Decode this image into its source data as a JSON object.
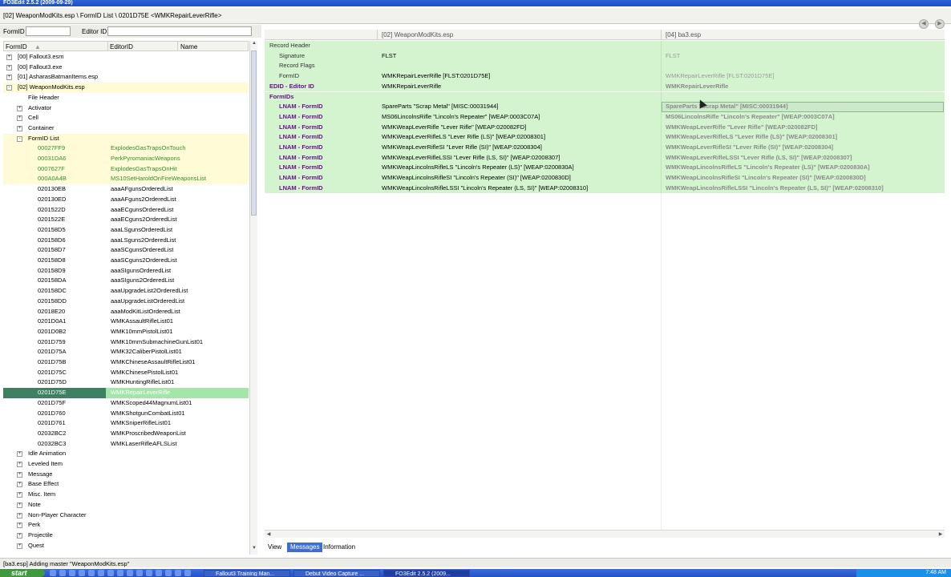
{
  "window": {
    "title": "FO3Edit 2.5.2 (2009-09-29)"
  },
  "path": {
    "text": "[02] WeaponModKits.esp \\ FormID List \\ 0201D75E <WMKRepairLeverRifle>"
  },
  "filter": {
    "formid_label": "FormID",
    "editorid_label": "Editor ID",
    "formid_value": "",
    "editorid_value": ""
  },
  "left_columns": {
    "formid": "FormID",
    "editorid": "EditorID",
    "name": "Name"
  },
  "tree": [
    {
      "indent": 0,
      "exp": "+",
      "text": "[00] Fallout3.esm",
      "edid": "",
      "hl": false
    },
    {
      "indent": 0,
      "exp": "+",
      "text": "[00] Fallout3.exe",
      "edid": "",
      "hl": false
    },
    {
      "indent": 0,
      "exp": "+",
      "text": "[01] AsharasBatmanItems.esp",
      "edid": "",
      "hl": false
    },
    {
      "indent": 0,
      "exp": "-",
      "text": "[02] WeaponModKits.esp",
      "edid": "",
      "hl": true
    },
    {
      "indent": 1,
      "exp": "",
      "text": "File Header",
      "edid": "",
      "hl": false
    },
    {
      "indent": 1,
      "exp": "+",
      "text": "Activator",
      "edid": "",
      "hl": false
    },
    {
      "indent": 1,
      "exp": "+",
      "text": "Cell",
      "edid": "",
      "hl": false
    },
    {
      "indent": 1,
      "exp": "+",
      "text": "Container",
      "edid": "",
      "hl": false
    },
    {
      "indent": 1,
      "exp": "-",
      "text": "FormID List",
      "edid": "",
      "hl": true
    },
    {
      "indent": 2,
      "exp": "",
      "text": "00027FF9",
      "edid": "ExplodesGasTrapsOnTouch",
      "hl": true,
      "green": true
    },
    {
      "indent": 2,
      "exp": "",
      "text": "00031DA6",
      "edid": "PerkPyromaniacWeapons",
      "hl": true,
      "green": true
    },
    {
      "indent": 2,
      "exp": "",
      "text": "0007627F",
      "edid": "ExplodesGasTrapsOnHit",
      "hl": true,
      "green": true
    },
    {
      "indent": 2,
      "exp": "",
      "text": "000A0A4B",
      "edid": "MS10SetHaroldOnFireWeaponsList",
      "hl": true,
      "green": true
    },
    {
      "indent": 2,
      "exp": "",
      "text": "020130EB",
      "edid": "aaaAFgunsOrderedList",
      "hl": false
    },
    {
      "indent": 2,
      "exp": "",
      "text": "020130ED",
      "edid": "aaaAFguns2OrderedList",
      "hl": false
    },
    {
      "indent": 2,
      "exp": "",
      "text": "0201522D",
      "edid": "aaaECgunsOrderedList",
      "hl": false
    },
    {
      "indent": 2,
      "exp": "",
      "text": "0201522E",
      "edid": "aaaECguns2OrderedList",
      "hl": false
    },
    {
      "indent": 2,
      "exp": "",
      "text": "020158D5",
      "edid": "aaaLSgunsOrderedList",
      "hl": false
    },
    {
      "indent": 2,
      "exp": "",
      "text": "020158D6",
      "edid": "aaaLSguns2OrderedList",
      "hl": false
    },
    {
      "indent": 2,
      "exp": "",
      "text": "020158D7",
      "edid": "aaaSCgunsOrderedList",
      "hl": false
    },
    {
      "indent": 2,
      "exp": "",
      "text": "020158D8",
      "edid": "aaaSCguns2OrderedList",
      "hl": false
    },
    {
      "indent": 2,
      "exp": "",
      "text": "020158D9",
      "edid": "aaaSIgunsOrderedList",
      "hl": false
    },
    {
      "indent": 2,
      "exp": "",
      "text": "020158DA",
      "edid": "aaaSIguns2OrderedList",
      "hl": false
    },
    {
      "indent": 2,
      "exp": "",
      "text": "020158DC",
      "edid": "aaaUpgradeList2OrderedList",
      "hl": false
    },
    {
      "indent": 2,
      "exp": "",
      "text": "020158DD",
      "edid": "aaaUpgradeListOrderedList",
      "hl": false
    },
    {
      "indent": 2,
      "exp": "",
      "text": "02018E20",
      "edid": "aaaModKitListOrderedList",
      "hl": false
    },
    {
      "indent": 2,
      "exp": "",
      "text": "0201D0A1",
      "edid": "WMKAssaultRifleList01",
      "hl": false
    },
    {
      "indent": 2,
      "exp": "",
      "text": "0201D0B2",
      "edid": "WMK10mmPistolList01",
      "hl": false
    },
    {
      "indent": 2,
      "exp": "",
      "text": "0201D759",
      "edid": "WMK10mmSubmachineGunList01",
      "hl": false
    },
    {
      "indent": 2,
      "exp": "",
      "text": "0201D75A",
      "edid": "WMK32CaliberPistolList01",
      "hl": false
    },
    {
      "indent": 2,
      "exp": "",
      "text": "0201D75B",
      "edid": "WMKChineseAssaultRifleList01",
      "hl": false
    },
    {
      "indent": 2,
      "exp": "",
      "text": "0201D75C",
      "edid": "WMKChinesePistolList01",
      "hl": false
    },
    {
      "indent": 2,
      "exp": "",
      "text": "0201D75D",
      "edid": "WMKHuntingRifleList01",
      "hl": false
    },
    {
      "indent": 2,
      "exp": "",
      "text": "0201D75E",
      "edid": "WMKRepairLeverRifle",
      "hl": false,
      "selected": true
    },
    {
      "indent": 2,
      "exp": "",
      "text": "0201D75F",
      "edid": "WMKScoped44MagnumList01",
      "hl": false
    },
    {
      "indent": 2,
      "exp": "",
      "text": "0201D760",
      "edid": "WMKShotgunCombatList01",
      "hl": false
    },
    {
      "indent": 2,
      "exp": "",
      "text": "0201D761",
      "edid": "WMKSniperRifleList01",
      "hl": false
    },
    {
      "indent": 2,
      "exp": "",
      "text": "02032BC2",
      "edid": "WMKProscribedWeaponList",
      "hl": false
    },
    {
      "indent": 2,
      "exp": "",
      "text": "02032BC3",
      "edid": "WMKLaserRifleAFLSList",
      "hl": false
    },
    {
      "indent": 1,
      "exp": "+",
      "text": "Idle Animation",
      "edid": "",
      "hl": false
    },
    {
      "indent": 1,
      "exp": "+",
      "text": "Leveled Item",
      "edid": "",
      "hl": false
    },
    {
      "indent": 1,
      "exp": "+",
      "text": "Message",
      "edid": "",
      "hl": false
    },
    {
      "indent": 1,
      "exp": "+",
      "text": "Base Effect",
      "edid": "",
      "hl": false
    },
    {
      "indent": 1,
      "exp": "+",
      "text": "Misc. Item",
      "edid": "",
      "hl": false
    },
    {
      "indent": 1,
      "exp": "+",
      "text": "Note",
      "edid": "",
      "hl": false
    },
    {
      "indent": 1,
      "exp": "+",
      "text": "Non-Player Character",
      "edid": "",
      "hl": false
    },
    {
      "indent": 1,
      "exp": "+",
      "text": "Perk",
      "edid": "",
      "hl": false
    },
    {
      "indent": 1,
      "exp": "+",
      "text": "Projectile",
      "edid": "",
      "hl": false
    },
    {
      "indent": 1,
      "exp": "+",
      "text": "Quest",
      "edid": "",
      "hl": false
    }
  ],
  "right_columns": {
    "col1": "[02] WeaponModKits.esp",
    "col2": "[04] ba3.esp"
  },
  "records": [
    {
      "label": "Record Header",
      "style": "plain",
      "indent": 0,
      "v1": "",
      "v2": "",
      "bold2": false
    },
    {
      "label": "Signature",
      "style": "plain",
      "indent": 2,
      "v1": "FLST",
      "v2": "FLST",
      "bold2": false
    },
    {
      "label": "Record Flags",
      "style": "plain",
      "indent": 2,
      "v1": "",
      "v2": "",
      "bold2": false
    },
    {
      "label": "FormID",
      "style": "plain",
      "indent": 2,
      "v1": "WMKRepairLeverRifle [FLST:0201D75E]",
      "v2": "WMKRepairLeverRifle [FLST:0201D75E]",
      "bold2": false
    },
    {
      "label": "EDID - Editor ID",
      "style": "purple",
      "indent": 0,
      "v1": "WMKRepairLeverRifle",
      "v2": "WMKRepairLeverRifle",
      "bold2": true
    },
    {
      "label": "FormIDs",
      "style": "purple",
      "indent": 0,
      "v1": "",
      "v2": "",
      "bold2": false
    },
    {
      "label": "LNAM - FormID",
      "style": "purple",
      "indent": 2,
      "v1": "SpareParts \"Scrap Metal\" [MISC:00031944]",
      "v2": "SpareParts \"Scrap Metal\" [MISC:00031944]",
      "bold2": true,
      "selected": true
    },
    {
      "label": "LNAM - FormID",
      "style": "purple",
      "indent": 2,
      "v1": "MS06LincolnsRifle \"Lincoln's Repeater\" [WEAP:0003C07A]",
      "v2": "MS06LincolnsRifle \"Lincoln's Repeater\" [WEAP:0003C07A]",
      "bold2": true
    },
    {
      "label": "LNAM - FormID",
      "style": "purple",
      "indent": 2,
      "v1": "WMKWeapLeverRifle \"Lever Rifle\" [WEAP:020082FD]",
      "v2": "WMKWeapLeverRifle \"Lever Rifle\" [WEAP:020082FD]",
      "bold2": true
    },
    {
      "label": "LNAM - FormID",
      "style": "purple",
      "indent": 2,
      "v1": "WMKWeapLeverRifleLS \"Lever Rifle (LS)\" [WEAP:02008301]",
      "v2": "WMKWeapLeverRifleLS \"Lever Rifle (LS)\" [WEAP:02008301]",
      "bold2": true
    },
    {
      "label": "LNAM - FormID",
      "style": "purple",
      "indent": 2,
      "v1": "WMKWeapLeverRifleSI \"Lever Rifle (SI)\" [WEAP:02008304]",
      "v2": "WMKWeapLeverRifleSI \"Lever Rifle (SI)\" [WEAP:02008304]",
      "bold2": true
    },
    {
      "label": "LNAM - FormID",
      "style": "purple",
      "indent": 2,
      "v1": "WMKWeapLeverRifleLSSI \"Lever Rifle (LS, SI)\" [WEAP:02008307]",
      "v2": "WMKWeapLeverRifleLSSI \"Lever Rifle (LS, SI)\" [WEAP:02008307]",
      "bold2": true
    },
    {
      "label": "LNAM - FormID",
      "style": "purple",
      "indent": 2,
      "v1": "WMKWeapLincolnsRifleLS \"Lincoln's Repeater (LS)\" [WEAP:0200830A]",
      "v2": "WMKWeapLincolnsRifleLS \"Lincoln's Repeater (LS)\" [WEAP:0200830A]",
      "bold2": true
    },
    {
      "label": "LNAM - FormID",
      "style": "purple",
      "indent": 2,
      "v1": "WMKWeapLincolnsRifleSI \"Lincoln's Repeater (SI)\" [WEAP:0200830D]",
      "v2": "WMKWeapLincolnsRifleSI \"Lincoln's Repeater (SI)\" [WEAP:0200830D]",
      "bold2": true
    },
    {
      "label": "LNAM - FormID",
      "style": "purple",
      "indent": 2,
      "v1": "WMKWeapLincolnsRifleLSSI \"Lincoln's Repeater (LS, SI)\" [WEAP:02008310]",
      "v2": "WMKWeapLincolnsRifleLSSI \"Lincoln's Repeater (LS, SI)\" [WEAP:02008310]",
      "bold2": true
    }
  ],
  "tabs": {
    "view": "View",
    "messages": "Messages",
    "information": "Information"
  },
  "status": {
    "message": "[ba3.esp] Adding master \"WeaponModKits.esp\""
  },
  "taskbar": {
    "start": "start",
    "items": [
      "Fallout3 Training Man...",
      "Debut Video Capture ...",
      "FO3Edit 2.5.2 (2009..."
    ],
    "clock": "7:48 AM"
  },
  "colors": {
    "record_green": "#d3f4cf",
    "label_purple": "#6a0f8f",
    "selected_green": "#a4e6a9",
    "tab_active": "#3e6fd0"
  }
}
